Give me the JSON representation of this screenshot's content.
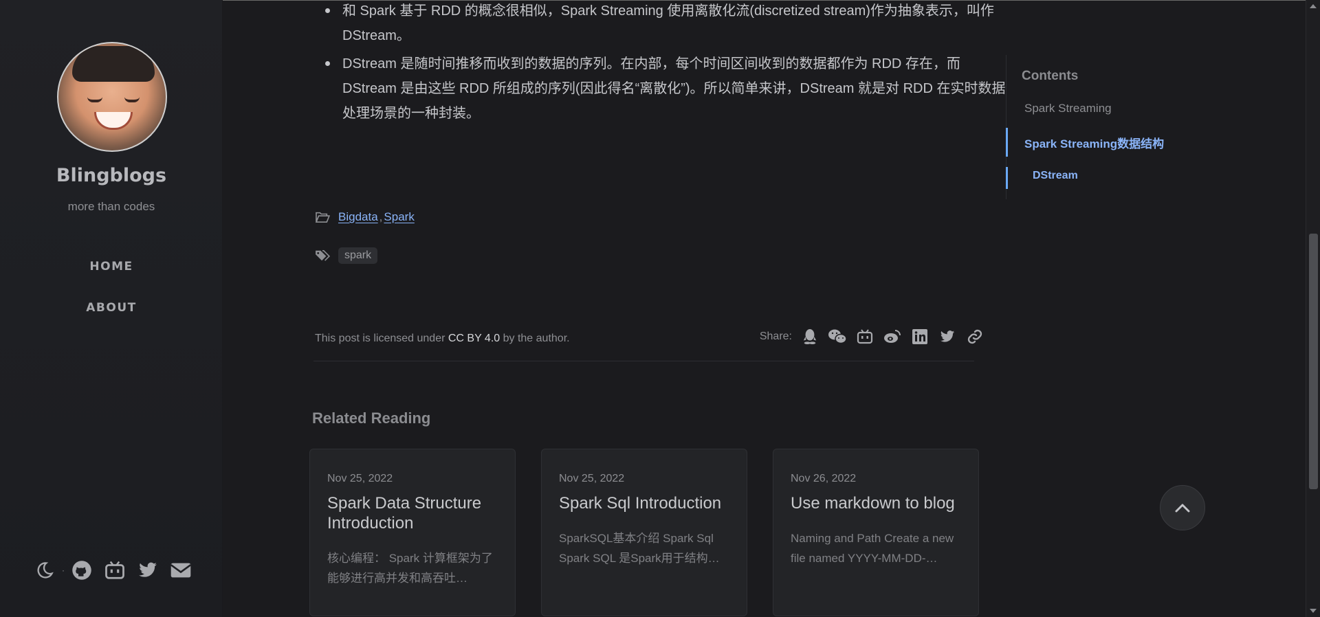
{
  "sidebar": {
    "title": "Blingblogs",
    "subtitle": "more than codes",
    "nav": [
      {
        "label": "HOME"
      },
      {
        "label": "ABOUT"
      }
    ],
    "bottom_icons": [
      "moon-icon",
      "github-icon",
      "bilibili-icon",
      "twitter-icon",
      "email-icon"
    ]
  },
  "post": {
    "bullets": [
      "和 Spark 基于 RDD 的概念很相似，Spark Streaming 使用离散化流(discretized stream)作为抽象表示，叫作 DStream。",
      "DStream 是随时间推移而收到的数据的序列。在内部，每个时间区间收到的数据都作为 RDD 存在，而 DStream 是由这些 RDD 所组成的序列(因此得名“离散化”)。所以简单来讲，DStream 就是对 RDD 在实时数据处理场景的一种封装。"
    ],
    "categories": [
      "Bigdata",
      "Spark"
    ],
    "category_separator": ",",
    "tags": [
      "spark"
    ],
    "license": {
      "prefix": "This post is licensed under ",
      "link": "CC BY 4.0",
      "suffix": " by the author."
    },
    "share": {
      "label": "Share:",
      "icons": [
        "qq-icon",
        "wechat-icon",
        "bilibili-icon",
        "weibo-icon",
        "linkedin-icon",
        "twitter-icon",
        "link-icon"
      ]
    }
  },
  "related": {
    "title": "Related Reading",
    "cards": [
      {
        "date": "Nov 25, 2022",
        "title": "Spark Data Structure Introduction",
        "excerpt": "核心编程： Spark 计算框架为了能够进行高并发和高吞吐…"
      },
      {
        "date": "Nov 25, 2022",
        "title": "Spark Sql Introduction",
        "excerpt": "SparkSQL基本介绍 Spark Sql Spark SQL 是Spark用于结构…"
      },
      {
        "date": "Nov 26, 2022",
        "title": "Use markdown to blog",
        "excerpt": "Naming and Path Create a new file named YYYY-MM-DD-…"
      }
    ]
  },
  "toc": {
    "heading": "Contents",
    "items": [
      {
        "label": "Spark Streaming",
        "active": false,
        "color": "#8e8f93"
      },
      {
        "label": "Spark Streaming数据结构",
        "active": true,
        "color": "#8ab4f8"
      },
      {
        "label": "DStream",
        "active": true,
        "color": "#8ab4f8"
      }
    ]
  },
  "colors": {
    "accent": "#8ab4f8",
    "background": "#1b1b1e",
    "sidebar": "#1f2024"
  }
}
